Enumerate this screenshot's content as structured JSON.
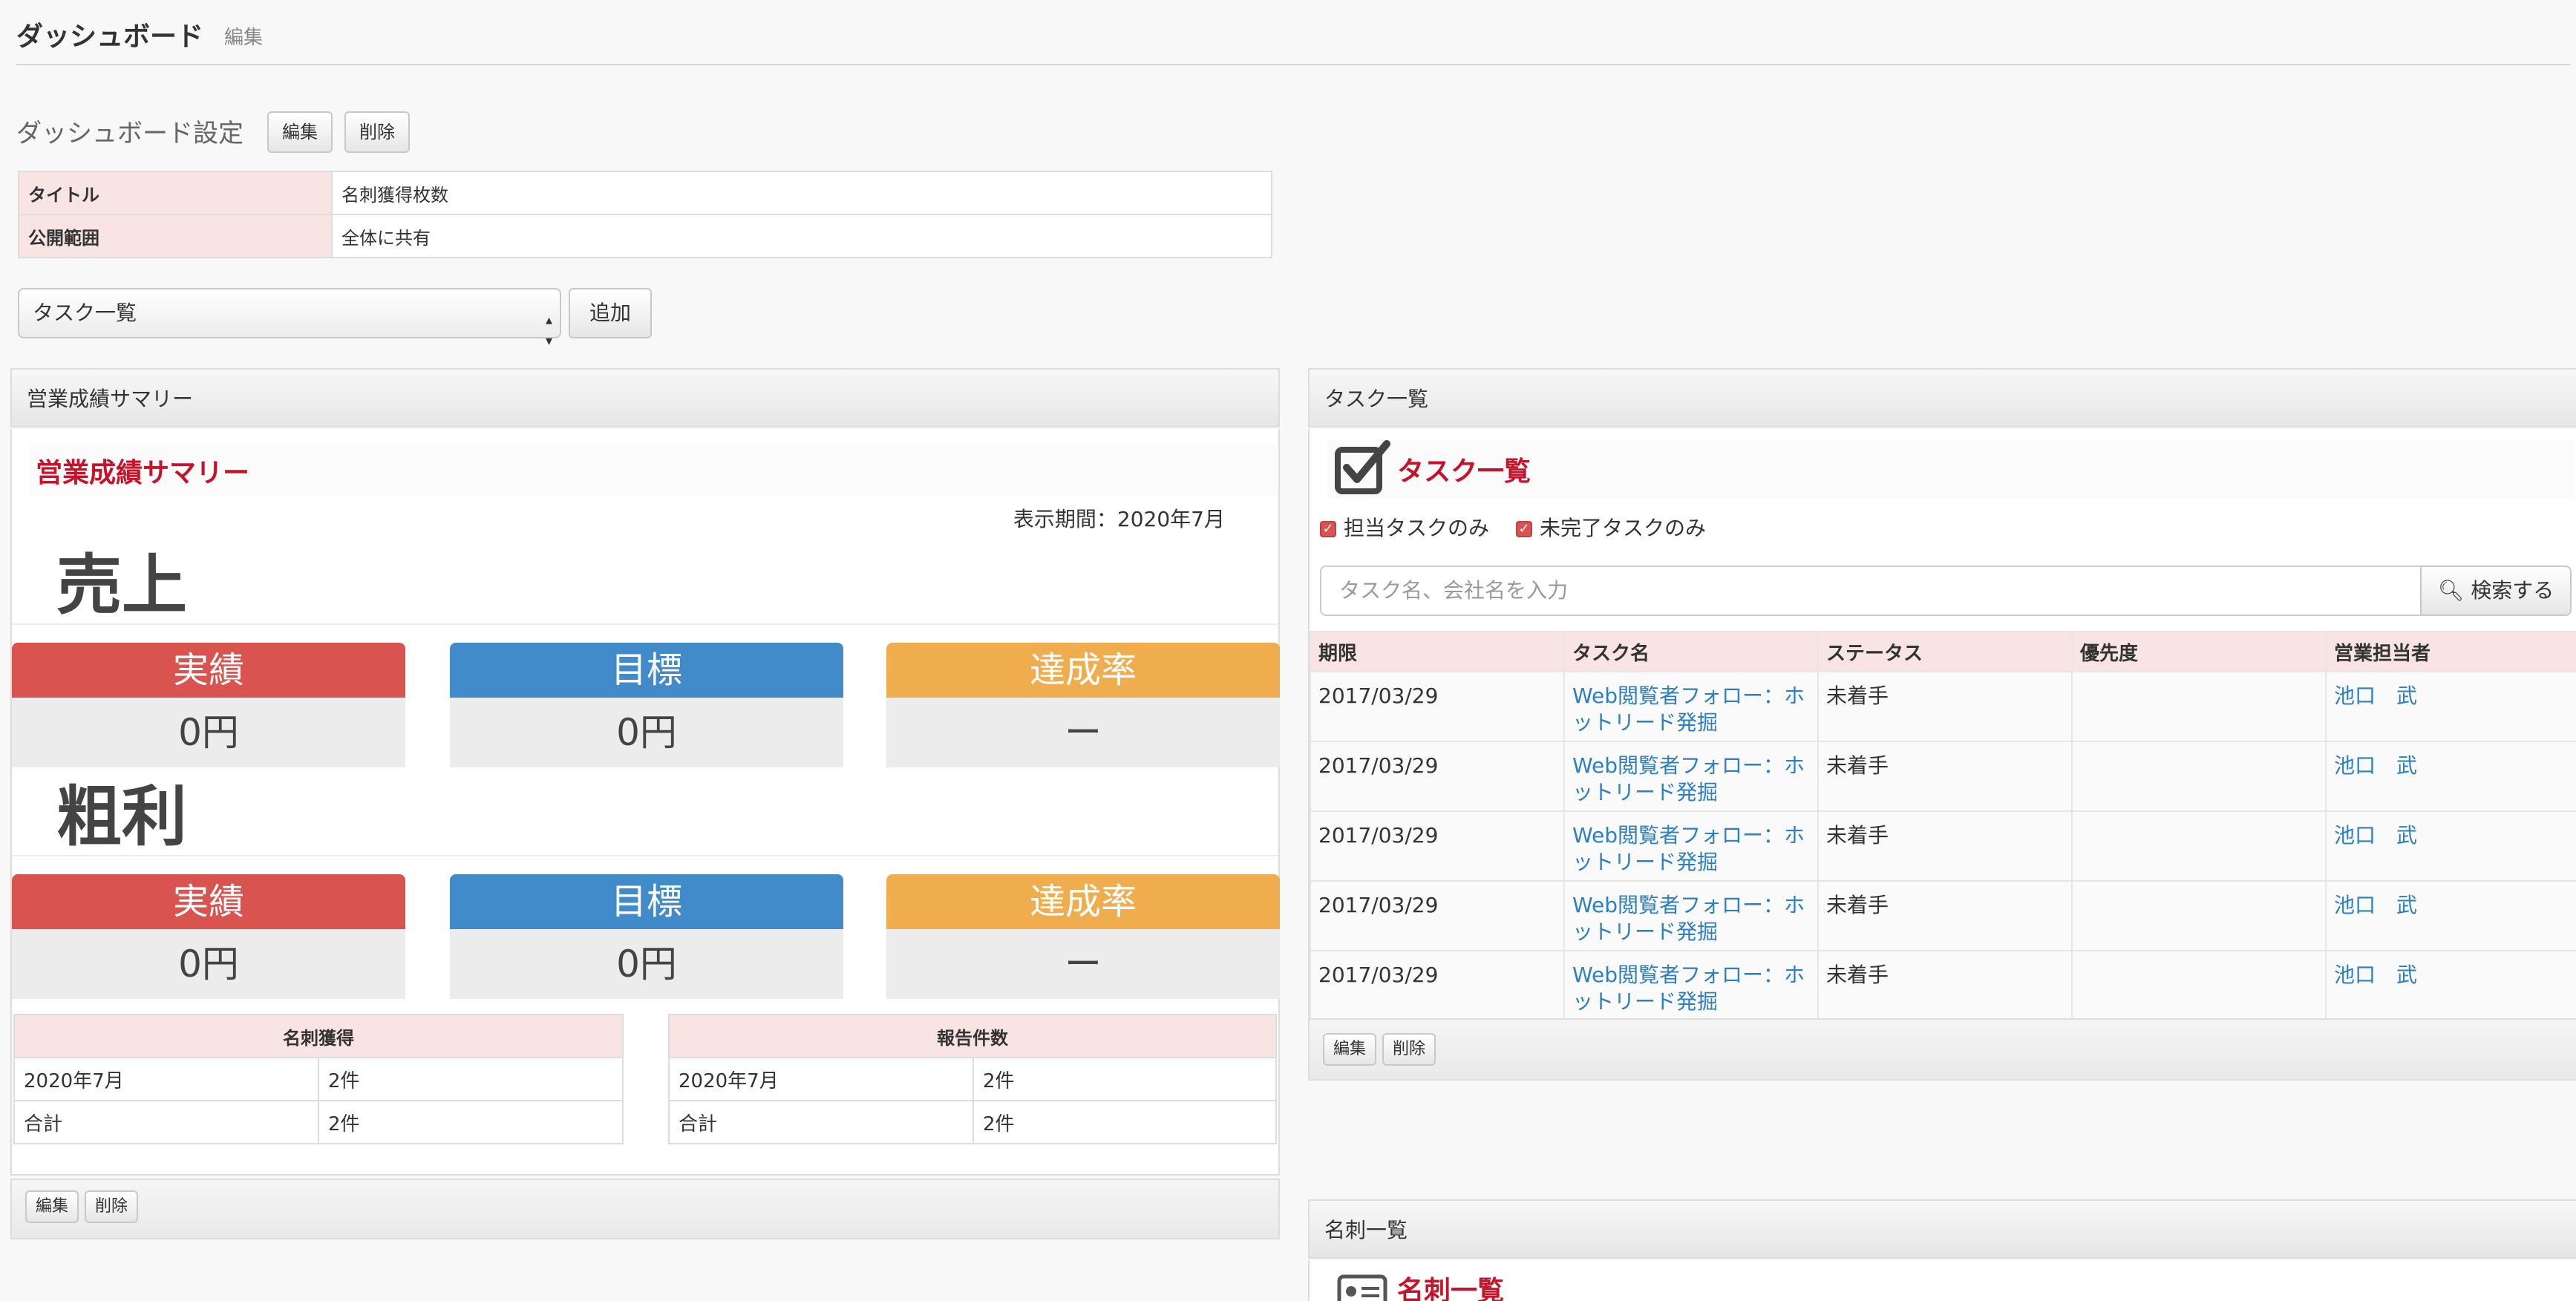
{
  "header": {
    "title": "ダッシュボード",
    "subtitle": "編集"
  },
  "settings": {
    "heading": "ダッシュボード設定",
    "edit_label": "編集",
    "delete_label": "削除",
    "rows": [
      {
        "key": "タイトル",
        "value": "名刺獲得枚数"
      },
      {
        "key": "公開範囲",
        "value": "全体に共有"
      }
    ]
  },
  "widget_picker": {
    "selected": "タスク一覧",
    "add_label": "追加"
  },
  "sales_panel": {
    "header": "営業成績サマリー",
    "title": "営業成績サマリー",
    "period": "表示期間：2020年7月",
    "sections": [
      {
        "heading": "売上",
        "kpis": [
          {
            "label": "実績",
            "value": "0円"
          },
          {
            "label": "目標",
            "value": "0円"
          },
          {
            "label": "達成率",
            "value": "ー"
          }
        ]
      },
      {
        "heading": "粗利",
        "kpis": [
          {
            "label": "実績",
            "value": "0円"
          },
          {
            "label": "目標",
            "value": "0円"
          },
          {
            "label": "達成率",
            "value": "ー"
          }
        ]
      }
    ],
    "tables": [
      {
        "header": "名刺獲得",
        "rows": [
          [
            "2020年7月",
            "2件"
          ],
          [
            "合計",
            "2件"
          ]
        ]
      },
      {
        "header": "報告件数",
        "rows": [
          [
            "2020年7月",
            "2件"
          ],
          [
            "合計",
            "2件"
          ]
        ]
      }
    ],
    "edit_label": "編集",
    "delete_label": "削除"
  },
  "tasks_panel": {
    "header": "タスク一覧",
    "title": "タスク一覧",
    "filters": [
      "担当タスクのみ",
      "未完了タスクのみ"
    ],
    "search_placeholder": "タスク名、会社名を入力",
    "search_button": "検索する",
    "columns": [
      "期限",
      "タスク名",
      "ステータス",
      "優先度",
      "営業担当者"
    ],
    "rows": [
      {
        "due": "2017/03/29",
        "name": "Web閲覧者フォロー：ホットリード発掘",
        "status": "未着手",
        "priority": "",
        "owner": "池口　武"
      },
      {
        "due": "2017/03/29",
        "name": "Web閲覧者フォロー：ホットリード発掘",
        "status": "未着手",
        "priority": "",
        "owner": "池口　武"
      },
      {
        "due": "2017/03/29",
        "name": "Web閲覧者フォロー：ホットリード発掘",
        "status": "未着手",
        "priority": "",
        "owner": "池口　武"
      },
      {
        "due": "2017/03/29",
        "name": "Web閲覧者フォロー：ホットリード発掘",
        "status": "未着手",
        "priority": "",
        "owner": "池口　武"
      },
      {
        "due": "2017/03/29",
        "name": "Web閲覧者フォロー：ホットリード発掘",
        "status": "未着手",
        "priority": "",
        "owner": "池口　武"
      }
    ],
    "edit_label": "編集",
    "delete_label": "削除"
  },
  "cards_panel": {
    "header": "名刺一覧",
    "title": "名刺一覧"
  },
  "colors": {
    "accent_red": "#c7132a",
    "kpi_actual": "#d9534f",
    "kpi_target": "#428bca",
    "kpi_rate": "#f0ad4e",
    "link": "#2a7fc6"
  }
}
